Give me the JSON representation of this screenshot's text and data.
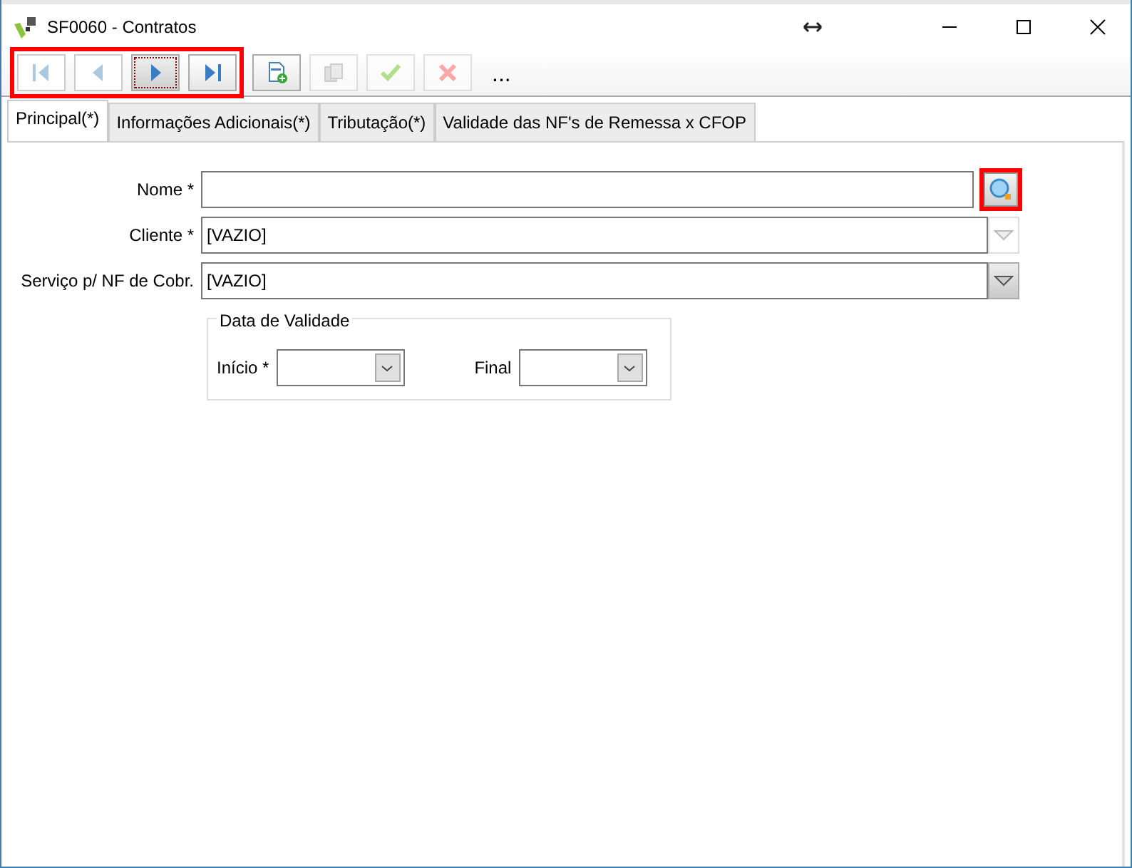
{
  "window": {
    "title": "SF0060 - Contratos"
  },
  "toolbar": {
    "navigation_highlighted": true,
    "buttons": [
      {
        "kind": "first",
        "disabled": true,
        "focused": false
      },
      {
        "kind": "prev",
        "disabled": true,
        "focused": false
      },
      {
        "kind": "next",
        "disabled": false,
        "focused": true
      },
      {
        "kind": "last",
        "disabled": false,
        "focused": false
      },
      {
        "kind": "new",
        "disabled": false,
        "focused": false
      },
      {
        "kind": "copy",
        "disabled": true,
        "focused": false
      },
      {
        "kind": "confirm",
        "disabled": true,
        "focused": false
      },
      {
        "kind": "cancel",
        "disabled": true,
        "focused": false
      }
    ],
    "more": "..."
  },
  "tabs": [
    {
      "label": "Principal(*)",
      "selected": true
    },
    {
      "label": "Informações Adicionais(*)",
      "selected": false
    },
    {
      "label": "Tributação(*)",
      "selected": false
    },
    {
      "label": "Validade das NF's de Remessa x CFOP",
      "selected": false
    }
  ],
  "fields": [
    {
      "kind": "search",
      "label": "Nome *",
      "highlighted": true
    },
    {
      "kind": "combo",
      "label": "Cliente *",
      "value": "[VAZIO]",
      "disabled": true
    },
    {
      "kind": "combo",
      "label": "Serviço p/ NF de Cobr.",
      "value": "[VAZIO]",
      "disabled": false
    }
  ],
  "validity": {
    "title": "Data de Validade",
    "fields": [
      {
        "label": "Início *"
      },
      {
        "label": "Final"
      }
    ]
  }
}
